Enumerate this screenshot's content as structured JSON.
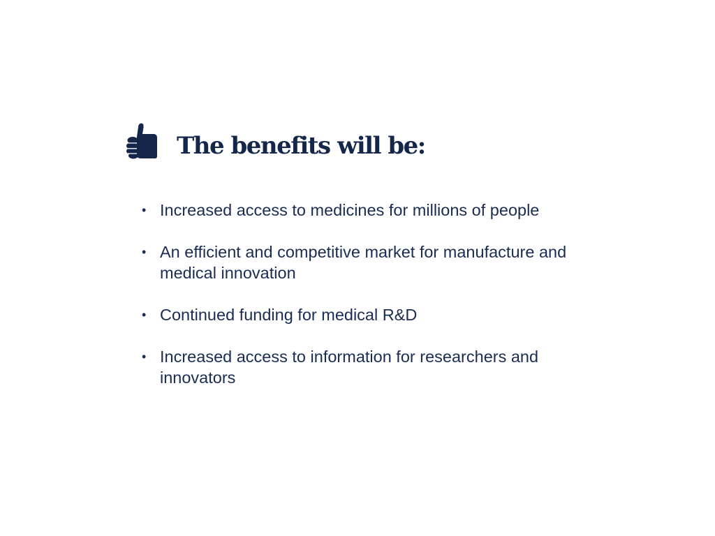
{
  "slide": {
    "icon": "thumbs-up-icon",
    "title": "The benefits will be:",
    "bullets": [
      {
        "text": "Increased access to medicines for millions of people"
      },
      {
        "text": "An efficient and competitive market for manufacture and medical innovation"
      },
      {
        "text": "Continued funding for medical R&D"
      },
      {
        "text": "Increased access to information for researchers and innovators"
      }
    ]
  },
  "colors": {
    "navy": "#14264a",
    "text": "#1a2c52",
    "background": "#ffffff"
  }
}
